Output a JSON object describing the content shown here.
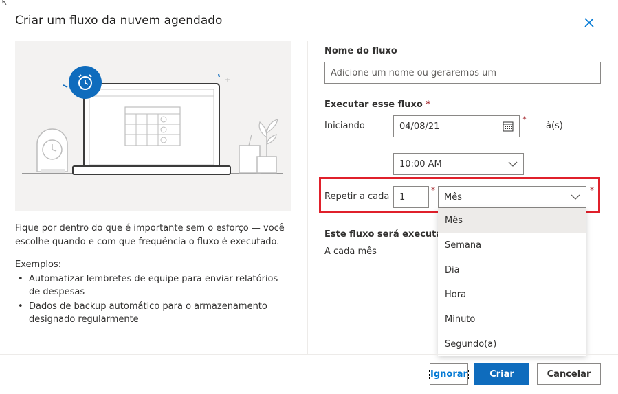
{
  "dialog": {
    "title": "Criar um fluxo da nuvem agendado"
  },
  "left": {
    "description": "Fique por dentro do que é importante sem o esforço — você escolhe quando e com que frequência o fluxo é executado.",
    "examples_heading": "Exemplos:",
    "examples": [
      "Automatizar lembretes de equipe para enviar relatórios de despesas",
      "Dados de backup automático para o armazenamento designado regularmente"
    ]
  },
  "form": {
    "flow_name_label": "Nome do fluxo",
    "flow_name_placeholder": "Adicione um nome ou geraremos um",
    "run_label": "Executar esse fluxo",
    "required_mark": "*",
    "starting_label": "Iniciando",
    "start_date": "04/08/21",
    "at_label": "à(s)",
    "start_time": "10:00 AM",
    "repeat_label": "Repetir a cada",
    "repeat_interval": "1",
    "repeat_unit": "Mês",
    "summary_label": "Este fluxo será executado:",
    "summary_value": "A cada mês"
  },
  "unit_options": [
    "Mês",
    "Semana",
    "Dia",
    "Hora",
    "Minuto",
    "Segundo(a)"
  ],
  "footer": {
    "skip_label": "Ignorar",
    "create_label": "Criar",
    "cancel_label": "Cancelar"
  },
  "colors": {
    "accent": "#0f6cbd",
    "highlight_box": "#e0202b",
    "required": "#a4262c"
  }
}
